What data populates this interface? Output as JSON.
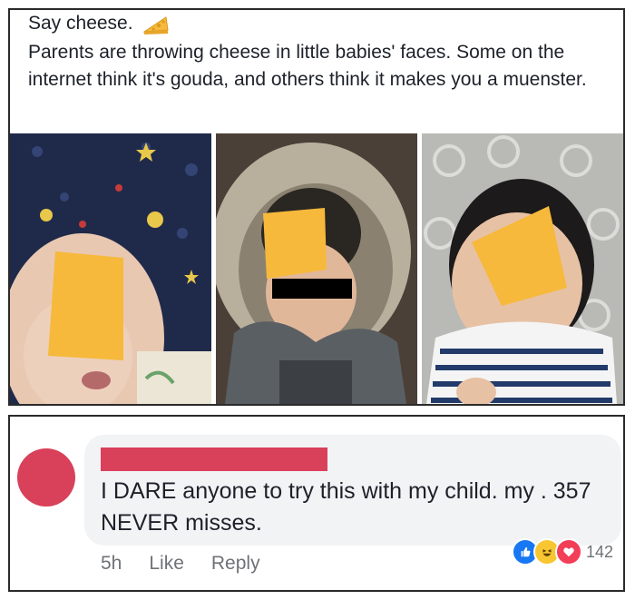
{
  "post": {
    "title": "Say cheese.",
    "title_emoji": "cheese-icon",
    "body": "Parents are throwing cheese in little babies' faces. Some on the internet think it's gouda, and others think it makes you a muenster.",
    "photos": [
      {
        "label": "baby-with-cheese-1"
      },
      {
        "label": "baby-with-cheese-2"
      },
      {
        "label": "baby-with-cheese-3"
      }
    ]
  },
  "comment": {
    "text": "I DARE anyone to try this with my child. my . 357 NEVER misses.",
    "time": "5h",
    "like_label": "Like",
    "reply_label": "Reply",
    "reaction_icons": [
      "like-icon",
      "haha-icon",
      "love-icon"
    ],
    "reaction_count": "142"
  },
  "colors": {
    "redaction": "#d9405a",
    "bubble": "#f2f3f5",
    "cheese": "#f6b93b"
  }
}
